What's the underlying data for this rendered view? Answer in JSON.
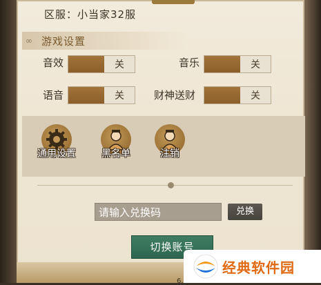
{
  "server": {
    "label": "区服：小当家32服"
  },
  "game_settings": {
    "title": "游戏设置",
    "rows": [
      {
        "label": "音效",
        "value": "关"
      },
      {
        "label": "音乐",
        "value": "关"
      },
      {
        "label": "语音",
        "value": "关"
      },
      {
        "label": "财神送财",
        "value": "关"
      }
    ]
  },
  "shortcuts": [
    {
      "label": "通用设置",
      "icon": "gear-icon"
    },
    {
      "label": "黑名单",
      "icon": "character-icon"
    },
    {
      "label": "注销",
      "icon": "character-icon"
    }
  ],
  "redeem": {
    "placeholder": "请输入兑换码",
    "button": "兑换"
  },
  "switch_account": {
    "label": "切换账号"
  },
  "version": "6.25.1",
  "watermark": {
    "text": "经典软件园"
  },
  "colors": {
    "accent_green": "#2e6650",
    "toggle_brown": "#8c5f2a",
    "panel": "#f0e8d8"
  }
}
